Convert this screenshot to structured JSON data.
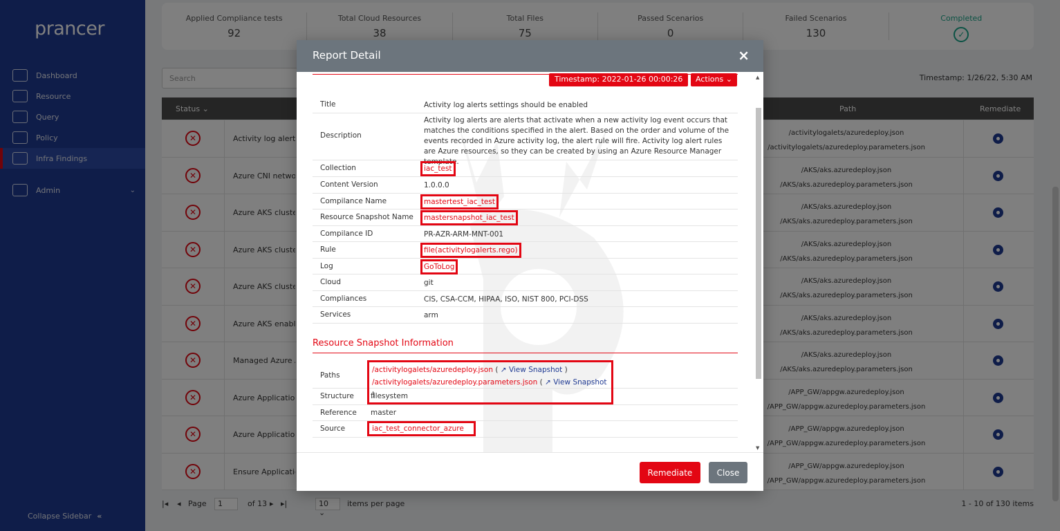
{
  "sidebar": {
    "logo": "prancer",
    "items": [
      {
        "label": "Dashboard",
        "icon": "dashboard-icon"
      },
      {
        "label": "Resource",
        "icon": "resource-icon"
      },
      {
        "label": "Query",
        "icon": "query-icon"
      },
      {
        "label": "Policy",
        "icon": "policy-icon"
      },
      {
        "label": "Infra Findings",
        "icon": "infra-findings-icon",
        "active": true
      },
      {
        "label": "Admin",
        "icon": "admin-icon"
      }
    ],
    "collapse_label": "Collapse Sidebar"
  },
  "stats": [
    {
      "label": "Applied Compliance tests",
      "value": "92"
    },
    {
      "label": "Total Cloud Resources",
      "value": "38"
    },
    {
      "label": "Total Files",
      "value": "75"
    },
    {
      "label": "Passed Scenarios",
      "value": "0"
    },
    {
      "label": "Failed Scenarios",
      "value": "130"
    },
    {
      "label": "Completed",
      "value": "✓"
    }
  ],
  "search": {
    "placeholder": "Search"
  },
  "timestamp_right": "Timestamp: 1/26/22, 5:30 AM",
  "table": {
    "headers": {
      "status": "Status",
      "path": "Path",
      "remediate": "Remediate"
    },
    "rows": [
      {
        "name": "Activity log alerts settings",
        "path1": "/activitylogalets/azuredeploy.json",
        "path2": "/activitylogalets/azuredeploy.parameters.json"
      },
      {
        "name": "Azure CNI network",
        "path1": "/AKS/aks.azuredeploy.json",
        "path2": "/AKS/aks.azuredeploy.parameters.json"
      },
      {
        "name": "Azure AKS cluster HTTP",
        "path1": "/AKS/aks.azuredeploy.json",
        "path2": "/AKS/aks.azuredeploy.parameters.json"
      },
      {
        "name": "Azure AKS cluster monitoring",
        "path1": "/AKS/aks.azuredeploy.json",
        "path2": "/AKS/aks.azuredeploy.parameters.json"
      },
      {
        "name": "Azure AKS cluster pool",
        "path1": "/AKS/aks.azuredeploy.json",
        "path2": "/AKS/aks.azuredeploy.parameters.json"
      },
      {
        "name": "Azure AKS enable RBAC",
        "path1": "/AKS/aks.azuredeploy.json",
        "path2": "/AKS/aks.azuredeploy.parameters.json"
      },
      {
        "name": "Managed Azure AD",
        "path1": "/AKS/aks.azuredeploy.json",
        "path2": "/AKS/aks.azuredeploy.parameters.json"
      },
      {
        "name": "Azure Application Gateway",
        "path1": "/APP_GW/appgw.azuredeploy.json",
        "path2": "/APP_GW/appgw.azuredeploy.parameters.json"
      },
      {
        "name": "Azure Application Gateway",
        "path1": "/APP_GW/appgw.azuredeploy.json",
        "path2": "/APP_GW/appgw.azuredeploy.parameters.json"
      },
      {
        "name": "Ensure Application Gateway",
        "path1": "/APP_GW/appgw.azuredeploy.json",
        "path2": "/APP_GW/appgw.azuredeploy.parameters.json"
      }
    ]
  },
  "pager": {
    "page_label": "Page",
    "page_value": "1",
    "of_label": "of 13",
    "per_page_value": "10",
    "per_page_label": "items per page",
    "range": "1 - 10 of 130 items"
  },
  "modal": {
    "title": "Report Detail",
    "close_glyph": "×",
    "timestamp": "Timestamp: 2022-01-26 00:00:26",
    "actions": "Actions",
    "details": {
      "title_k": "Title",
      "title_v": "Activity log alerts settings should be enabled",
      "desc_k": "Description",
      "desc_v": "Activity log alerts are alerts that activate when a new activity log event occurs that matches the conditions specified in the alert. Based on the order and volume of the events recorded in Azure activity log, the alert rule will fire. Activity log alert rules are Azure resources, so they can be created by using an Azure Resource Manager template.",
      "collection_k": "Collection",
      "collection_v": "iac_test",
      "content_k": "Content Version",
      "content_v": "1.0.0.0",
      "comp_name_k": "Compilance Name",
      "comp_name_v": "mastertest_iac_test",
      "snap_name_k": "Resource Snapshot Name",
      "snap_name_v": "mastersnapshot_iac_test",
      "comp_id_k": "Compilance ID",
      "comp_id_v": "PR-AZR-ARM-MNT-001",
      "rule_k": "Rule",
      "rule_v": "file(activitylogalerts.rego)",
      "log_k": "Log",
      "log_v": "GoToLog",
      "cloud_k": "Cloud",
      "cloud_v": "git",
      "compliances_k": "Compliances",
      "compliances_v": "CIS, CSA-CCM, HIPAA, ISO, NIST 800, PCI-DSS",
      "services_k": "Services",
      "services_v": "arm"
    },
    "snapshot_section": "Resource Snapshot Information",
    "snapshot": {
      "paths_k": "Paths",
      "path1": "/activitylogalets/azuredeploy.json",
      "path2": "/activitylogalets/azuredeploy.parameters.json",
      "view_snapshot": "View Snapshot",
      "open_paren": "(",
      "close_paren": ")",
      "structure_k": "Structure",
      "structure_v": "filesystem",
      "reference_k": "Reference",
      "reference_v": "master",
      "source_k": "Source",
      "source_v": "iac_test_connector_azure"
    },
    "remediate_btn": "Remediate",
    "close_btn": "Close"
  }
}
